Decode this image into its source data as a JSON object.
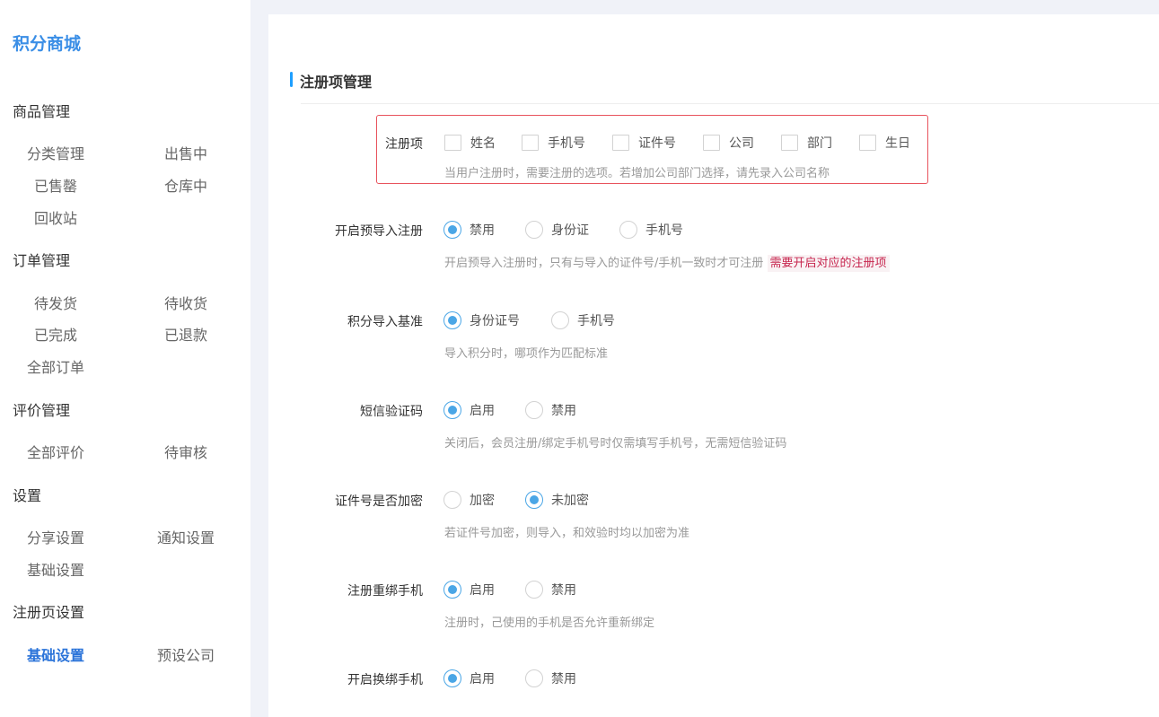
{
  "brand": "积分商城",
  "sidebar": {
    "groups": [
      {
        "title": "商品管理",
        "items": [
          "分类管理",
          "出售中",
          "已售罄",
          "仓库中",
          "回收站"
        ]
      },
      {
        "title": "订单管理",
        "items": [
          "待发货",
          "待收货",
          "已完成",
          "已退款",
          "全部订单"
        ]
      },
      {
        "title": "评价管理",
        "items": [
          "全部评价",
          "待审核"
        ]
      },
      {
        "title": "设置",
        "items": [
          "分享设置",
          "通知设置",
          "基础设置"
        ]
      },
      {
        "title": "注册页设置",
        "items": [
          "基础设置",
          "预设公司"
        ]
      }
    ],
    "active_item": "注册页设置/基础设置"
  },
  "section_title": "注册项管理",
  "reg_items": {
    "label": "注册项",
    "options": [
      "姓名",
      "手机号",
      "证件号",
      "公司",
      "部门",
      "生日"
    ],
    "checked": [
      false,
      false,
      false,
      false,
      false,
      false
    ],
    "hint": "当用户注册时，需要注册的选项。若增加公司部门选择，请先录入公司名称"
  },
  "rows": [
    {
      "label": "开启预导入注册",
      "options": [
        "禁用",
        "身份证",
        "手机号"
      ],
      "selected": 0,
      "hint": "开启预导入注册时，只有与导入的证件号/手机一致时才可注册",
      "warn": "需要开启对应的注册项"
    },
    {
      "label": "积分导入基准",
      "options": [
        "身份证号",
        "手机号"
      ],
      "selected": 0,
      "hint": "导入积分时，哪项作为匹配标准"
    },
    {
      "label": "短信验证码",
      "options": [
        "启用",
        "禁用"
      ],
      "selected": 0,
      "hint": "关闭后，会员注册/绑定手机号时仅需填写手机号，无需短信验证码"
    },
    {
      "label": "证件号是否加密",
      "options": [
        "加密",
        "未加密"
      ],
      "selected": 1,
      "hint": "若证件号加密，则导入，和效验时均以加密为准"
    },
    {
      "label": "注册重绑手机",
      "options": [
        "启用",
        "禁用"
      ],
      "selected": 0,
      "hint": "注册时，己使用的手机是否允许重新绑定"
    },
    {
      "label": "开启换绑手机",
      "options": [
        "启用",
        "禁用"
      ],
      "selected": 0
    }
  ],
  "colors": {
    "accent": "#4aa6e6",
    "brand": "#3a8ee6",
    "highlight_border": "#e8535d",
    "warn_text": "#c7254e"
  }
}
